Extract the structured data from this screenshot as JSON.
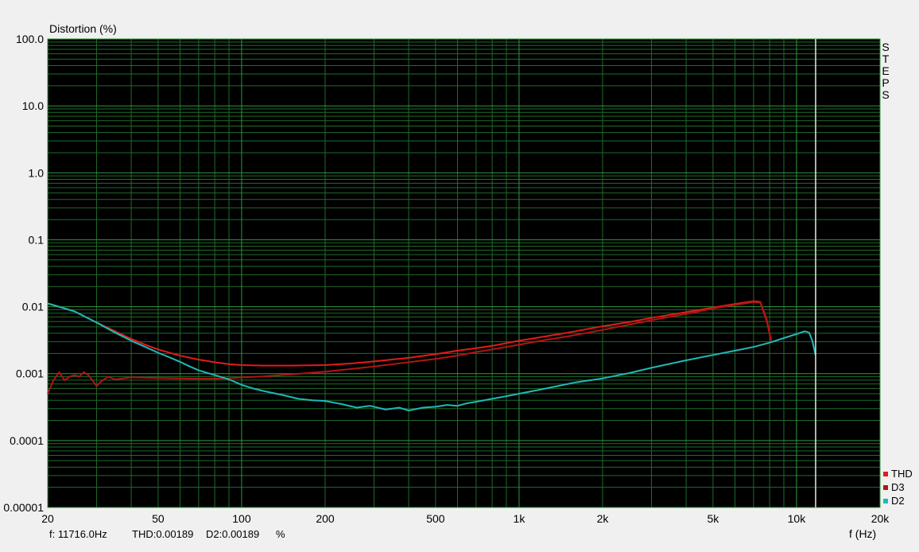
{
  "chart_data": {
    "type": "line",
    "ylabel": "Distortion (%)",
    "xlabel": "f (Hz)",
    "x_scale": "log",
    "y_scale": "log",
    "xlim": [
      20,
      20000
    ],
    "ylim": [
      1e-05,
      100
    ],
    "x_ticks": [
      {
        "value": 20,
        "label": "20"
      },
      {
        "value": 50,
        "label": "50"
      },
      {
        "value": 100,
        "label": "100"
      },
      {
        "value": 200,
        "label": "200"
      },
      {
        "value": 500,
        "label": "500"
      },
      {
        "value": 1000,
        "label": "1k"
      },
      {
        "value": 2000,
        "label": "2k"
      },
      {
        "value": 5000,
        "label": "5k"
      },
      {
        "value": 10000,
        "label": "10k"
      },
      {
        "value": 20000,
        "label": "20k"
      }
    ],
    "y_ticks": [
      {
        "value": 100,
        "label": "100.0"
      },
      {
        "value": 10,
        "label": "10.0"
      },
      {
        "value": 1,
        "label": "1.0"
      },
      {
        "value": 0.1,
        "label": "0.1"
      },
      {
        "value": 0.01,
        "label": "0.01"
      },
      {
        "value": 0.001,
        "label": "0.001"
      },
      {
        "value": 0.0001,
        "label": "0.0001"
      },
      {
        "value": 1e-05,
        "label": "0.00001"
      }
    ],
    "grid": true,
    "background": "#000000",
    "grid_color": "#1f6b2a",
    "grid_major_color": "#2e9a3a",
    "legend_position": "bottom-right",
    "side_label": "STEPS",
    "cursor_x": 11716,
    "series": [
      {
        "name": "THD",
        "color": "#e31b1b",
        "points": [
          [
            20,
            0.0112
          ],
          [
            25,
            0.0085
          ],
          [
            30,
            0.0058
          ],
          [
            35,
            0.0043
          ],
          [
            40,
            0.0033
          ],
          [
            45,
            0.0027
          ],
          [
            50,
            0.0023
          ],
          [
            60,
            0.00185
          ],
          [
            70,
            0.00162
          ],
          [
            80,
            0.00148
          ],
          [
            90,
            0.00138
          ],
          [
            100,
            0.00134
          ],
          [
            120,
            0.00132
          ],
          [
            150,
            0.00132
          ],
          [
            200,
            0.00134
          ],
          [
            250,
            0.00142
          ],
          [
            300,
            0.00152
          ],
          [
            400,
            0.00172
          ],
          [
            500,
            0.00195
          ],
          [
            600,
            0.0022
          ],
          [
            700,
            0.0024
          ],
          [
            800,
            0.0026
          ],
          [
            1000,
            0.0031
          ],
          [
            1200,
            0.0035
          ],
          [
            1500,
            0.0041
          ],
          [
            2000,
            0.0051
          ],
          [
            2500,
            0.0059
          ],
          [
            3000,
            0.0068
          ],
          [
            4000,
            0.0083
          ],
          [
            5000,
            0.0097
          ],
          [
            6000,
            0.011
          ],
          [
            7000,
            0.0121
          ],
          [
            7400,
            0.0118
          ],
          [
            7800,
            0.0065
          ],
          [
            8100,
            0.0031
          ]
        ]
      },
      {
        "name": "D3",
        "color": "#b01515",
        "points": [
          [
            20,
            0.0005
          ],
          [
            21,
            0.0008
          ],
          [
            22,
            0.00105
          ],
          [
            23,
            0.0008
          ],
          [
            24,
            0.0009
          ],
          [
            25,
            0.00095
          ],
          [
            26,
            0.0009
          ],
          [
            27,
            0.00105
          ],
          [
            28,
            0.00095
          ],
          [
            29,
            0.0008
          ],
          [
            30,
            0.00065
          ],
          [
            31,
            0.00075
          ],
          [
            33,
            0.0009
          ],
          [
            35,
            0.00082
          ],
          [
            40,
            0.00088
          ],
          [
            50,
            0.00086
          ],
          [
            60,
            0.00085
          ],
          [
            70,
            0.00084
          ],
          [
            80,
            0.00084
          ],
          [
            90,
            0.00085
          ],
          [
            100,
            0.00088
          ],
          [
            120,
            0.00091
          ],
          [
            150,
            0.00097
          ],
          [
            200,
            0.00107
          ],
          [
            250,
            0.00118
          ],
          [
            300,
            0.00128
          ],
          [
            400,
            0.00148
          ],
          [
            500,
            0.00166
          ],
          [
            600,
            0.00186
          ],
          [
            700,
            0.0021
          ],
          [
            800,
            0.0023
          ],
          [
            1000,
            0.0027
          ],
          [
            1200,
            0.0031
          ],
          [
            1500,
            0.0036
          ],
          [
            2000,
            0.0045
          ],
          [
            2500,
            0.0054
          ],
          [
            3000,
            0.0063
          ],
          [
            4000,
            0.0078
          ],
          [
            5000,
            0.0094
          ],
          [
            6000,
            0.0106
          ],
          [
            7000,
            0.0117
          ],
          [
            7400,
            0.0115
          ],
          [
            7800,
            0.0062
          ],
          [
            8100,
            0.0031
          ]
        ]
      },
      {
        "name": "D2",
        "color": "#20b8b8",
        "points": [
          [
            20,
            0.0112
          ],
          [
            25,
            0.0085
          ],
          [
            30,
            0.0058
          ],
          [
            35,
            0.0041
          ],
          [
            40,
            0.0031
          ],
          [
            45,
            0.0025
          ],
          [
            50,
            0.00205
          ],
          [
            55,
            0.00175
          ],
          [
            60,
            0.0015
          ],
          [
            65,
            0.00128
          ],
          [
            70,
            0.00112
          ],
          [
            80,
            0.00095
          ],
          [
            90,
            0.00082
          ],
          [
            100,
            0.00068
          ],
          [
            110,
            0.0006
          ],
          [
            120,
            0.00055
          ],
          [
            140,
            0.00048
          ],
          [
            160,
            0.00042
          ],
          [
            180,
            0.0004
          ],
          [
            200,
            0.00039
          ],
          [
            230,
            0.00035
          ],
          [
            260,
            0.00031
          ],
          [
            290,
            0.00033
          ],
          [
            330,
            0.00029
          ],
          [
            370,
            0.00031
          ],
          [
            400,
            0.00028
          ],
          [
            450,
            0.00031
          ],
          [
            500,
            0.00032
          ],
          [
            550,
            0.00034
          ],
          [
            600,
            0.00033
          ],
          [
            650,
            0.00036
          ],
          [
            700,
            0.00038
          ],
          [
            800,
            0.00042
          ],
          [
            900,
            0.00046
          ],
          [
            1000,
            0.0005
          ],
          [
            1200,
            0.00058
          ],
          [
            1400,
            0.00066
          ],
          [
            1600,
            0.00074
          ],
          [
            2000,
            0.00085
          ],
          [
            2500,
            0.00102
          ],
          [
            3000,
            0.00122
          ],
          [
            4000,
            0.00158
          ],
          [
            5000,
            0.0019
          ],
          [
            6000,
            0.0022
          ],
          [
            7000,
            0.0025
          ],
          [
            8000,
            0.0029
          ],
          [
            9000,
            0.0034
          ],
          [
            10000,
            0.0039
          ],
          [
            10700,
            0.0043
          ],
          [
            11100,
            0.0041
          ],
          [
            11400,
            0.0031
          ],
          [
            11716,
            0.00189
          ]
        ]
      }
    ]
  },
  "status": {
    "freq": "f: 11716.0Hz",
    "thd": "THD:0.00189",
    "d2": "D2:0.00189",
    "unit": "%"
  }
}
